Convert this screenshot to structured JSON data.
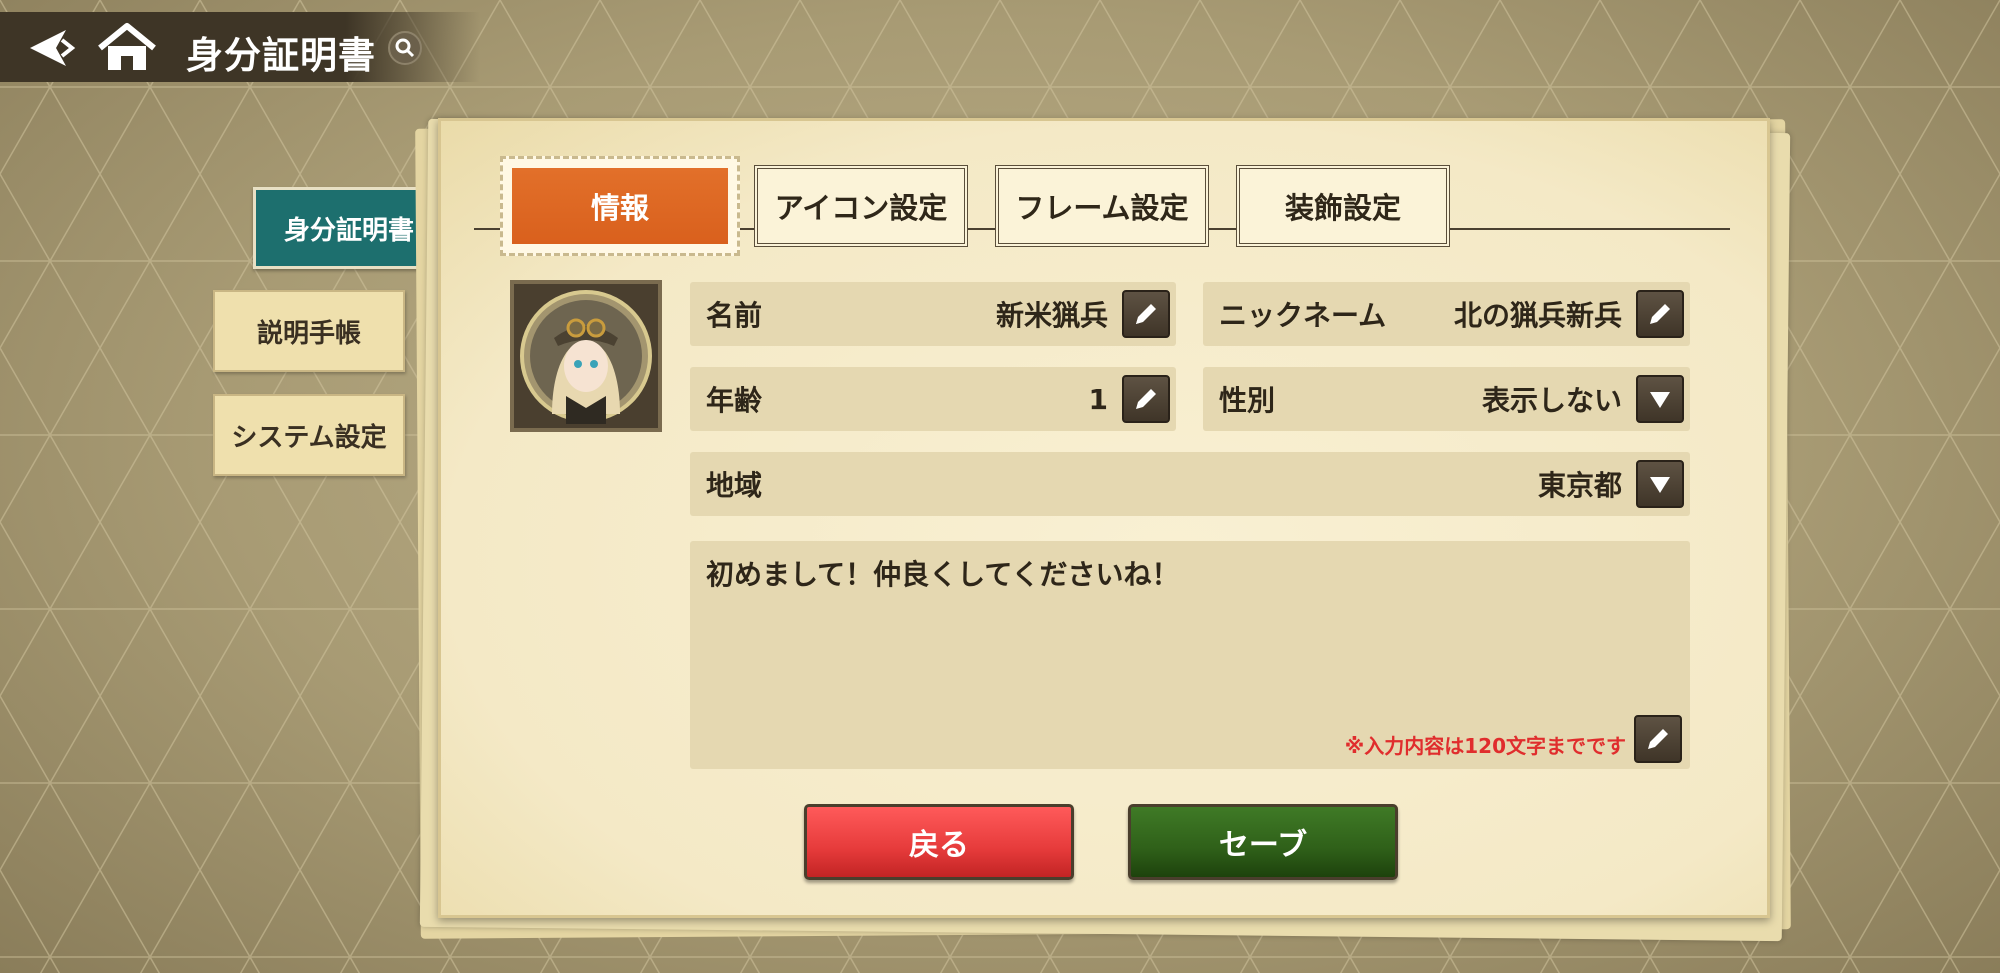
{
  "header": {
    "title": "身分証明書"
  },
  "sidebar": {
    "items": [
      {
        "label": "身分証明書",
        "active": true
      },
      {
        "label": "説明手帳",
        "active": false
      },
      {
        "label": "システム設定",
        "active": false
      }
    ]
  },
  "tabs": [
    {
      "label": "情報",
      "active": true
    },
    {
      "label": "アイコン設定",
      "active": false
    },
    {
      "label": "フレーム設定",
      "active": false
    },
    {
      "label": "装飾設定",
      "active": false
    }
  ],
  "profile": {
    "name_label": "名前",
    "name_value": "新米猟兵",
    "nickname_label": "ニックネーム",
    "nickname_value": "北の猟兵新兵",
    "age_label": "年齢",
    "age_value": "1",
    "gender_label": "性別",
    "gender_value": "表示しない",
    "region_label": "地域",
    "region_value": "東京都",
    "bio_text": "初めまして！仲良くしてくださいね！",
    "bio_note": "※入力内容は120文字までです"
  },
  "buttons": {
    "back_label": "戻る",
    "save_label": "セーブ"
  },
  "colors": {
    "active_tab": "#e2702a",
    "active_sidebar": "#1d6f6e",
    "back_button": "#e63b3b",
    "save_button": "#2f6019",
    "note_text": "#e02d2d"
  },
  "icons": [
    "back-arrow-icon",
    "home-icon",
    "search-icon",
    "pencil-icon",
    "dropdown-triangle-icon"
  ]
}
